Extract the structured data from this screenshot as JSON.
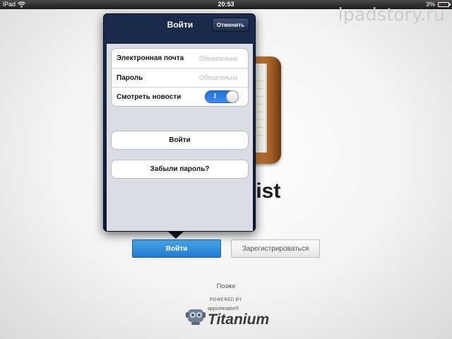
{
  "status_bar": {
    "carrier": "iPad",
    "time": "20:53",
    "battery": "3%"
  },
  "watermark": "ipadstory.ru",
  "background": {
    "app_name": "list",
    "login_button": "Войти",
    "register_button": "Зарегистрироваться",
    "later_link": "Позже",
    "powered_by": "POWERED BY",
    "logo_sub": "appcelerator®",
    "logo_text": "Titanium"
  },
  "popover": {
    "title": "Войти",
    "cancel_label": "Отменить",
    "fields": [
      {
        "label": "Электронная почта",
        "placeholder": "Обязательно"
      },
      {
        "label": "Пароль",
        "placeholder": "Обязательно"
      }
    ],
    "news_toggle": {
      "label": "Смотреть новости",
      "state_text": "I",
      "value": "on"
    },
    "login_button": "Войти",
    "forgot_button": "Забыли пароль?"
  },
  "colors": {
    "accent": "#2a88dd",
    "popover_bg": "#13223f"
  }
}
